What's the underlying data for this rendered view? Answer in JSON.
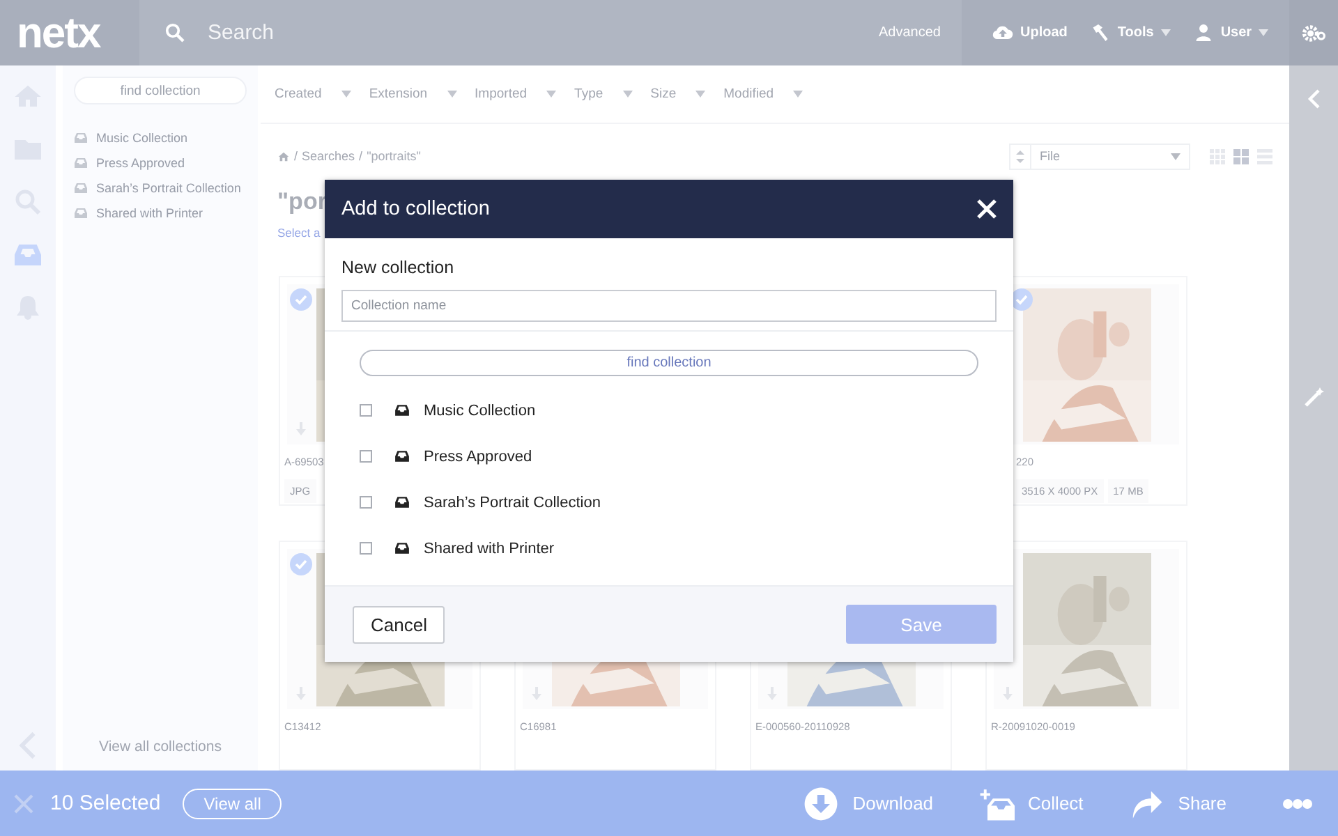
{
  "topbar": {
    "logo": "netx",
    "search": {
      "placeholder": "Search"
    },
    "advanced": "Advanced",
    "actions": [
      {
        "label": "Upload",
        "dropdown": false
      },
      {
        "label": "Tools",
        "dropdown": true
      },
      {
        "label": "User",
        "dropdown": true
      }
    ]
  },
  "nav_rail": [
    {
      "selected": false
    },
    {
      "selected": false
    },
    {
      "selected": false
    },
    {
      "selected": true
    },
    {
      "selected": false
    }
  ],
  "sidebar": {
    "search": {
      "placeholder": "find collection"
    },
    "collections": [
      "Music Collection",
      "Press Approved",
      "Sarah’s Portrait Collection",
      "Shared with Printer"
    ],
    "footer": "View all collections"
  },
  "filters": [
    "Created",
    "Extension",
    "Imported",
    "Type",
    "Size",
    "Modified"
  ],
  "breadcrumb": {
    "separator": "/",
    "trail": [
      "Searches"
    ],
    "current": "\"portraits\""
  },
  "sort": {
    "value": "File"
  },
  "view_modes": [
    {
      "kind": "small-grid",
      "selected": false
    },
    {
      "kind": "grid",
      "selected": true
    },
    {
      "kind": "list",
      "selected": false
    }
  ],
  "title": "\"por",
  "select_all": "Select a",
  "asset_rows": [
    [
      {
        "kind": "picture",
        "checked": true,
        "name": "A-69503",
        "tags": [
          "JPG"
        ]
      },
      {
        "kind": "picture",
        "checked": true,
        "name": "220",
        "tags": [
          "3516 X 4000 PX",
          "17 MB"
        ]
      }
    ],
    [
      {
        "kind": "picture",
        "checked": true,
        "name": "C13412"
      },
      {
        "kind": "picture",
        "checked": false,
        "name": "C16981"
      },
      {
        "kind": "picture",
        "checked": false,
        "name": "E-000560-20110928"
      },
      {
        "kind": "picture",
        "checked": false,
        "name": "R-20091020-0019"
      }
    ]
  ],
  "modal": {
    "title": "Add to collection",
    "new_label": "New collection",
    "name_field": {
      "placeholder": "Collection name"
    },
    "find": {
      "placeholder": "find collection"
    },
    "collections": [
      {
        "name": "Music Collection",
        "checked": false
      },
      {
        "name": "Press Approved",
        "checked": false
      },
      {
        "name": "Sarah’s Portrait Collection",
        "checked": false
      },
      {
        "name": "Shared with Printer",
        "checked": false
      }
    ],
    "cancel": "Cancel",
    "save": {
      "label": "Save",
      "disabled": true
    }
  },
  "selection_bar": {
    "count": "10 Selected",
    "view_all": "View all",
    "actions": [
      "Download",
      "Collect",
      "Share"
    ]
  }
}
